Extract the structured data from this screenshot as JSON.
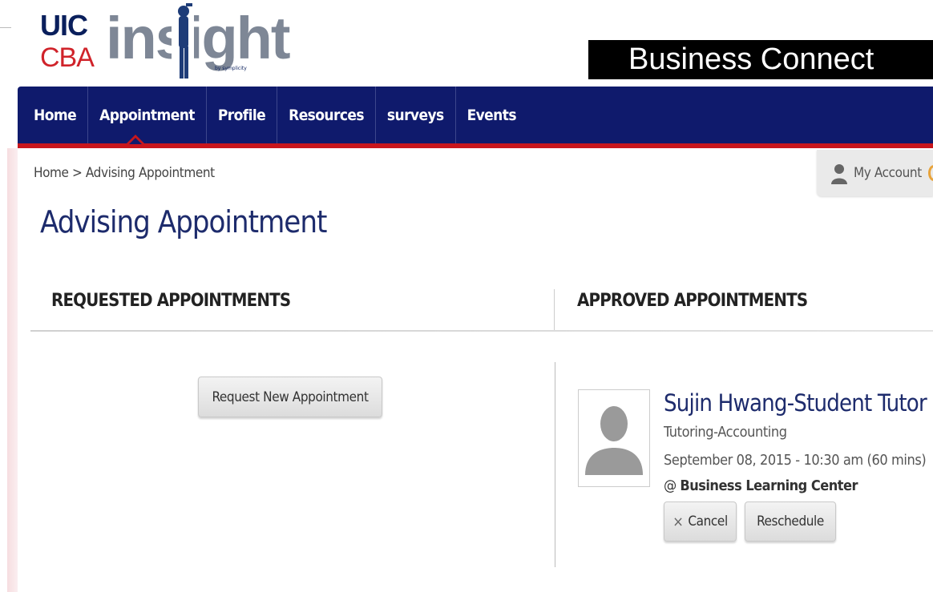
{
  "header": {
    "logo_uic": "UIC",
    "logo_cba": "CBA",
    "logo_insight": "insight",
    "logo_tagline": "by symplicity",
    "brand": "Business Connect"
  },
  "nav": {
    "items": [
      "Home",
      "Appointment",
      "Profile",
      "Resources",
      "surveys",
      "Events"
    ],
    "active": "Appointment"
  },
  "breadcrumb": "Home > Advising Appointment",
  "account": {
    "label": "My Account"
  },
  "page_title": "Advising Appointment",
  "requested": {
    "heading": "REQUESTED APPOINTMENTS",
    "request_button": "Request New Appointment"
  },
  "approved": {
    "heading": "APPROVED APPOINTMENTS",
    "appointment": {
      "advisor": "Sujin Hwang-Student Tutor",
      "type": "Tutoring-Accounting",
      "datetime": "September 08, 2015 - 10:30 am (60 mins)",
      "location_prefix": "@",
      "location": "Business Learning Center",
      "cancel_label": "Cancel",
      "cancel_icon": "×",
      "reschedule_label": "Reschedule"
    }
  },
  "colors": {
    "nav_bg": "#0f1a6c",
    "nav_accent": "#c8161d",
    "title_blue": "#1d2b6c",
    "brand_red": "#d0232a"
  }
}
